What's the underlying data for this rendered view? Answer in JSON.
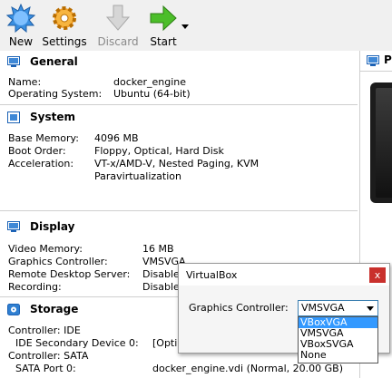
{
  "toolbar": {
    "new_label": "New",
    "settings_label": "Settings",
    "discard_label": "Discard",
    "start_label": "Start"
  },
  "general": {
    "title": "General",
    "name_label": "Name:",
    "name_value": "docker_engine",
    "os_label": "Operating System:",
    "os_value": "Ubuntu (64-bit)"
  },
  "system": {
    "title": "System",
    "memory_label": "Base Memory:",
    "memory_value": "4096 MB",
    "boot_label": "Boot Order:",
    "boot_value": "Floppy, Optical, Hard Disk",
    "accel_label": "Acceleration:",
    "accel_value_1": "VT-x/AMD-V, Nested Paging, KVM",
    "accel_value_2": "Paravirtualization"
  },
  "display": {
    "title": "Display",
    "video_label": "Video Memory:",
    "video_value": "16 MB",
    "gc_label": "Graphics Controller:",
    "gc_value": "VMSVGA",
    "rds_label": "Remote Desktop Server:",
    "rds_value": "Disable",
    "rec_label": "Recording:",
    "rec_value": "Disable"
  },
  "storage": {
    "title": "Storage",
    "ctrl_ide": "Controller: IDE",
    "ide_dev_label": "IDE Secondary Device 0:",
    "ide_dev_value": "[Opti",
    "ctrl_sata": "Controller: SATA",
    "sata_label": "SATA Port 0:",
    "sata_value": "docker_engine.vdi (Normal, 20.00 GB)"
  },
  "preview": {
    "title": "P"
  },
  "dialog": {
    "title": "VirtualBox",
    "close": "x",
    "label": "Graphics Controller:",
    "selected": "VMSVGA",
    "options": [
      "VBoxVGA",
      "VMSVGA",
      "VBoxSVGA",
      "None"
    ]
  }
}
